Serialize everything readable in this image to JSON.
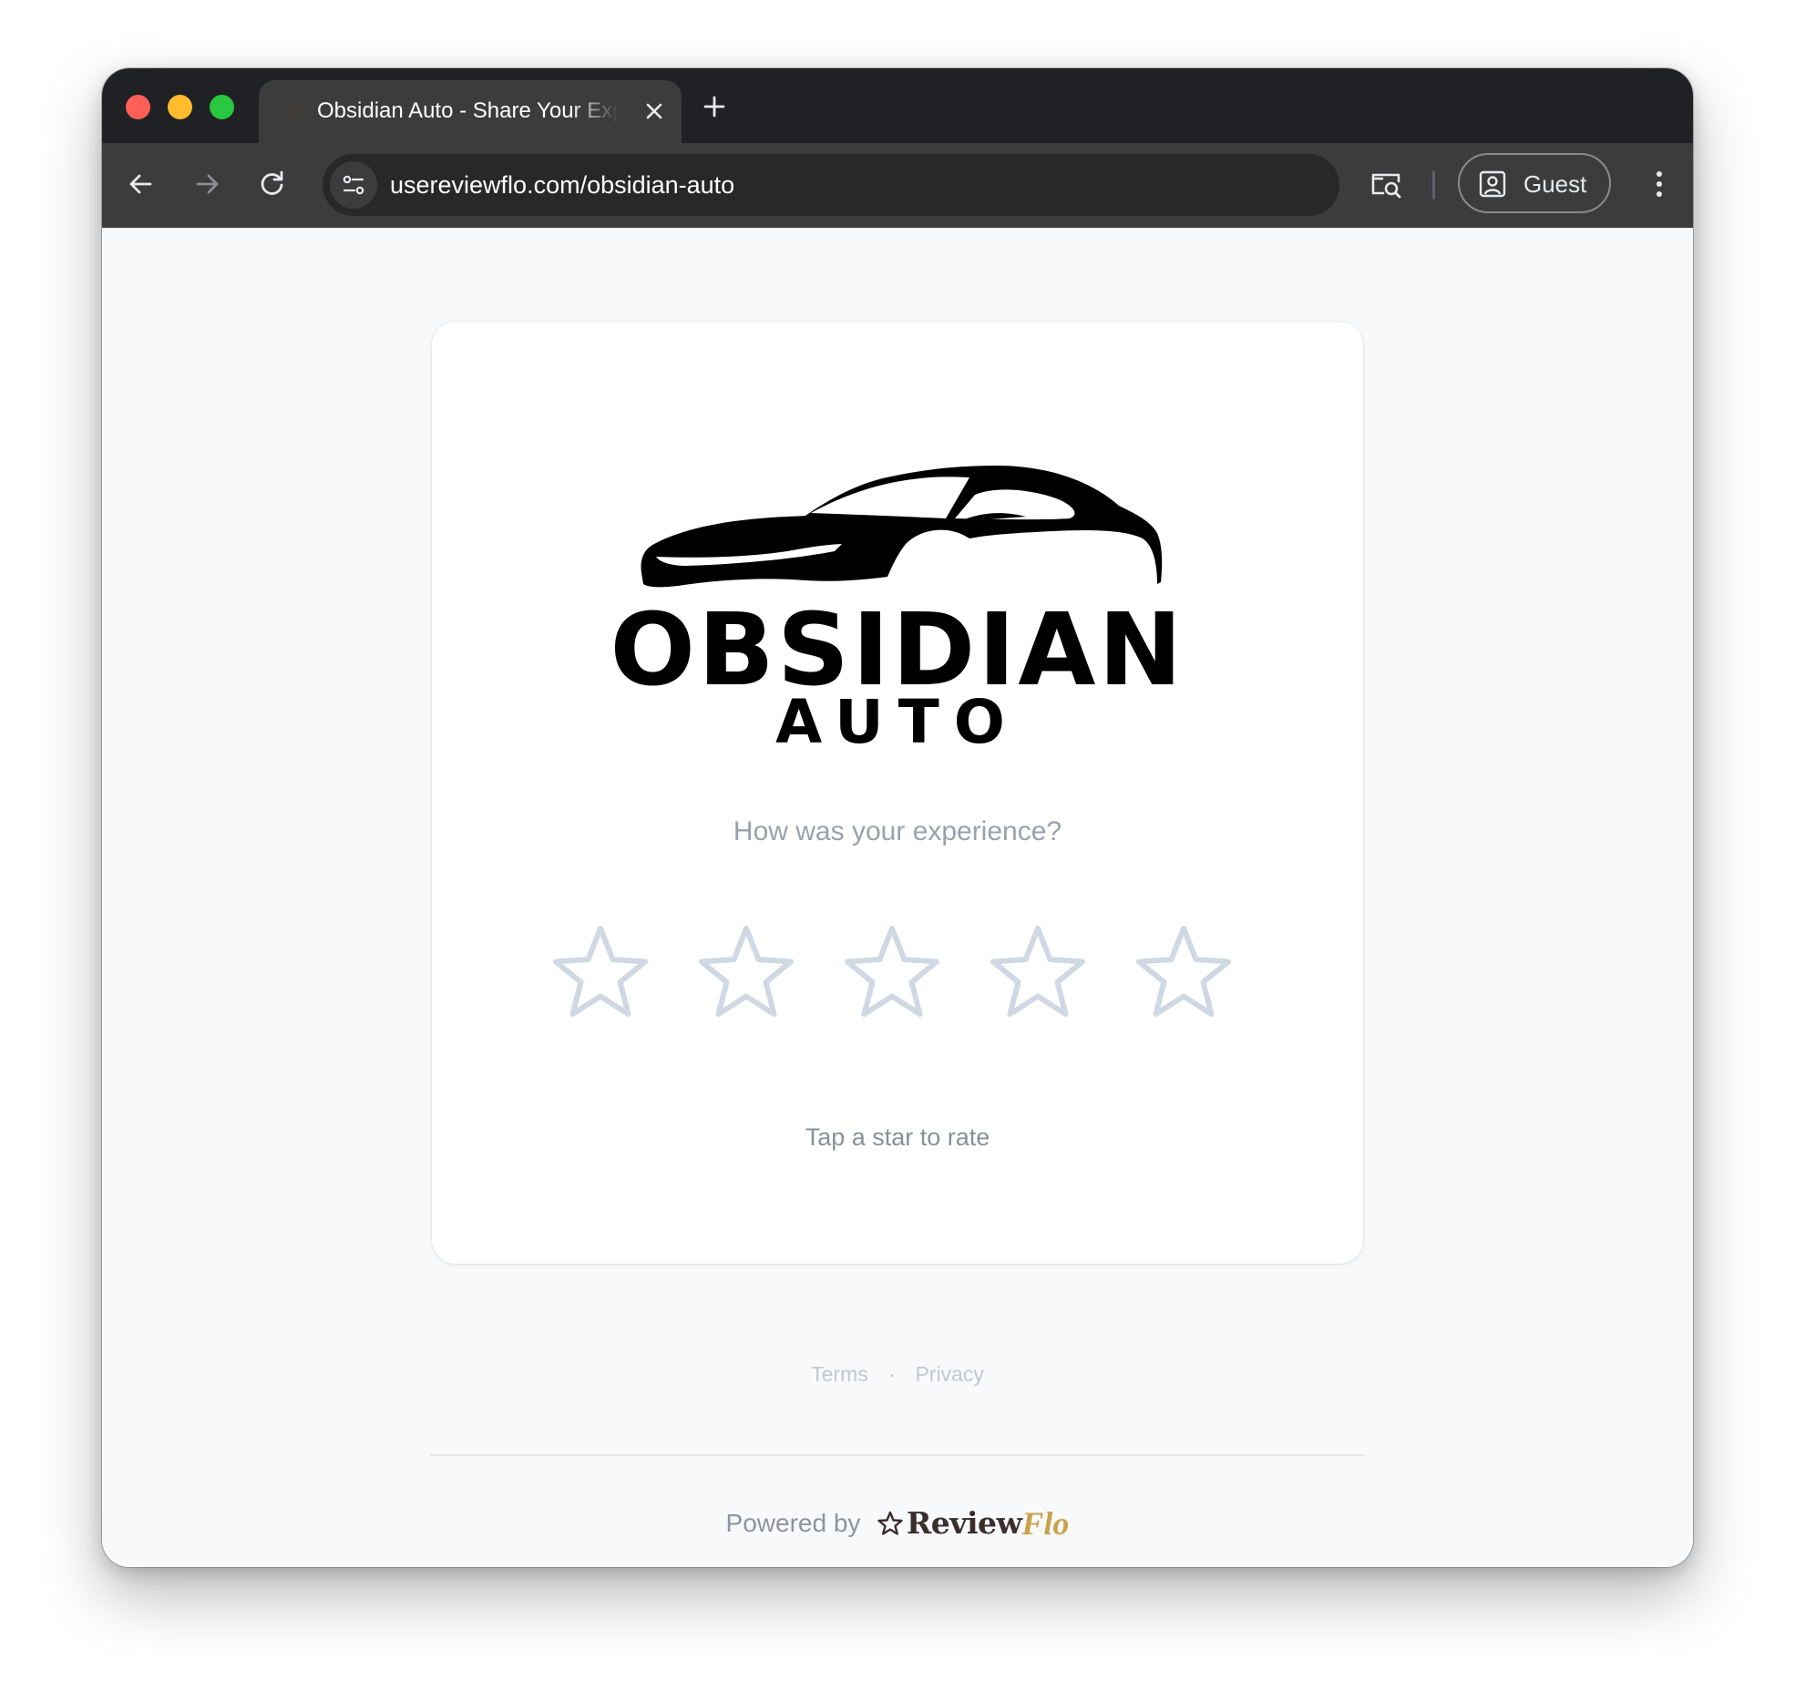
{
  "browser": {
    "tab": {
      "title": "Obsidian Auto - Share Your Experience",
      "favicon_icon": "star-icon"
    },
    "address_bar": {
      "url": "usereviewflo.com/obsidian-auto"
    },
    "profile": {
      "label": "Guest"
    }
  },
  "page": {
    "logo": {
      "name": "OBSIDIAN",
      "subname": "AUTO"
    },
    "question": "How was your experience?",
    "rating": {
      "max": 5,
      "value": 0,
      "hint": "Tap a star to rate",
      "empty_star_color": "#cfd8e3"
    },
    "footer": {
      "terms": "Terms",
      "separator": "·",
      "privacy": "Privacy"
    },
    "powered_by": {
      "label": "Powered by",
      "brand_part1": "Review",
      "brand_part2": "Flo",
      "brand_color_dark": "#3a2f2d",
      "brand_color_gold": "#c9a349"
    }
  }
}
